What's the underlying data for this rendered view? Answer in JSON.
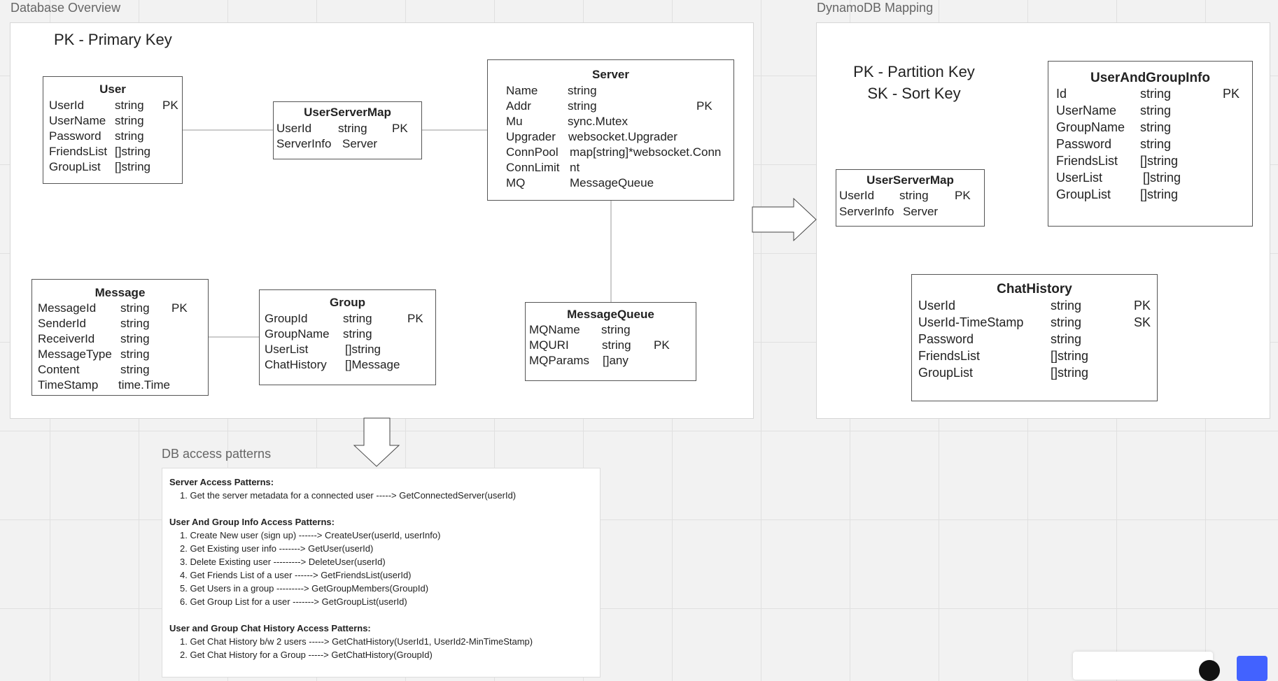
{
  "frames": {
    "overview_label": "Database Overview",
    "dynamo_label": "DynamoDB Mapping",
    "access_label": "DB access patterns"
  },
  "legends": {
    "primary_key": "PK - Primary Key",
    "partition_key": "PK - Partition Key",
    "sort_key": "SK - Sort Key"
  },
  "overview": {
    "user": {
      "title": "User",
      "rows": [
        [
          "UserId",
          "string",
          "PK"
        ],
        [
          "UserName",
          "string",
          ""
        ],
        [
          "Password",
          "string",
          ""
        ],
        [
          "FriendsList",
          "[]string",
          ""
        ],
        [
          "GroupList",
          "[]string",
          ""
        ]
      ]
    },
    "user_server_map": {
      "title": "UserServerMap",
      "rows": [
        [
          "UserId",
          "string",
          "PK"
        ],
        [
          "ServerInfo",
          "Server",
          ""
        ]
      ]
    },
    "server": {
      "title": "Server",
      "rows": [
        [
          "Name",
          "string",
          ""
        ],
        [
          "Addr",
          "string",
          "PK"
        ],
        [
          "Mu",
          "sync.Mutex",
          ""
        ],
        [
          "Upgrader",
          "websocket.Upgrader",
          ""
        ],
        [
          "ConnPool",
          "map[string]*websocket.Conn",
          ""
        ],
        [
          "ConnLimit",
          "nt",
          ""
        ],
        [
          "MQ",
          "MessageQueue",
          ""
        ]
      ]
    },
    "message": {
      "title": "Message",
      "rows": [
        [
          "MessageId",
          "string",
          "PK"
        ],
        [
          "SenderId",
          "string",
          ""
        ],
        [
          "ReceiverId",
          "string",
          ""
        ],
        [
          "MessageType",
          "string",
          ""
        ],
        [
          "Content",
          "string",
          ""
        ],
        [
          "TimeStamp",
          "time.Time",
          ""
        ]
      ]
    },
    "group": {
      "title": "Group",
      "rows": [
        [
          "GroupId",
          "string",
          "PK"
        ],
        [
          "GroupName",
          "string",
          ""
        ],
        [
          "UserList",
          "[]string",
          ""
        ],
        [
          "ChatHistory",
          "[]Message",
          ""
        ]
      ]
    },
    "message_queue": {
      "title": "MessageQueue",
      "rows": [
        [
          "MQName",
          "string",
          ""
        ],
        [
          "MQURI",
          "string",
          "PK"
        ],
        [
          "MQParams",
          "[]any",
          ""
        ]
      ]
    }
  },
  "dynamo": {
    "user_server_map": {
      "title": "UserServerMap",
      "rows": [
        [
          "UserId",
          "string",
          "PK"
        ],
        [
          "ServerInfo",
          "Server",
          ""
        ]
      ]
    },
    "user_and_group_info": {
      "title": "UserAndGroupInfo",
      "rows": [
        [
          "Id",
          "string",
          "PK"
        ],
        [
          "UserName",
          "string",
          ""
        ],
        [
          "GroupName",
          "string",
          ""
        ],
        [
          "Password",
          "string",
          ""
        ],
        [
          "FriendsList",
          "[]string",
          ""
        ],
        [
          "UserList",
          "[]string",
          ""
        ],
        [
          "GroupList",
          "[]string",
          ""
        ]
      ]
    },
    "chat_history": {
      "title": "ChatHistory",
      "rows": [
        [
          "UserId",
          "string",
          "PK"
        ],
        [
          "UserId-TimeStamp",
          "string",
          "SK"
        ],
        [
          "Password",
          "string",
          ""
        ],
        [
          "FriendsList",
          "[]string",
          ""
        ],
        [
          "GroupList",
          "[]string",
          ""
        ]
      ]
    }
  },
  "access_patterns": {
    "server_heading": "Server Access Patterns:",
    "server_items": [
      "1. Get the server metadata for a connected user ----->     GetConnectedServer(userId)"
    ],
    "user_group_heading": "User And Group Info Access Patterns:",
    "user_group_items": [
      "1. Create New user (sign up) ------> CreateUser(userId, userInfo)",
      "2. Get Existing user info -------> GetUser(userId)",
      "3. Delete Existing user ---------> DeleteUser(userId)",
      "4. Get Friends List of a user ------> GetFriendsList(userId)",
      "5. Get Users in a group ---------> GetGroupMembers(GroupId)",
      "6. Get Group List for a user -------> GetGroupList(userId)"
    ],
    "chat_heading": "User and Group Chat History Access Patterns:",
    "chat_items": [
      "1. Get Chat History b/w 2 users -----> GetChatHistory(UserId1, UserId2-MinTimeStamp)",
      "2. Get Chat History for a Group -----> GetChatHistory(GroupId)"
    ]
  }
}
